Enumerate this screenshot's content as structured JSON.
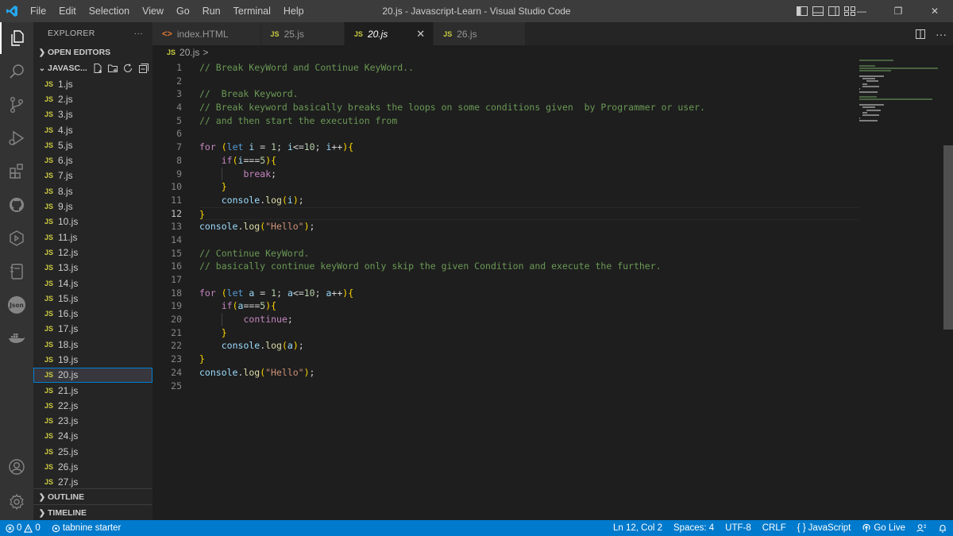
{
  "titlebar": {
    "menu": [
      "File",
      "Edit",
      "Selection",
      "View",
      "Go",
      "Run",
      "Terminal",
      "Help"
    ],
    "window_title": "20.js - Javascript-Learn - Visual Studio Code"
  },
  "sidebar": {
    "title": "EXPLORER",
    "more": "···",
    "open_editors": "OPEN EDITORS",
    "folder": "JAVASC...",
    "files": [
      "1.js",
      "2.js",
      "3.js",
      "4.js",
      "5.js",
      "6.js",
      "7.js",
      "8.js",
      "9.js",
      "10.js",
      "11.js",
      "12.js",
      "13.js",
      "14.js",
      "15.js",
      "16.js",
      "17.js",
      "18.js",
      "19.js",
      "20.js",
      "21.js",
      "22.js",
      "23.js",
      "24.js",
      "25.js",
      "26.js",
      "27.js"
    ],
    "selected_file": "20.js",
    "outline": "OUTLINE",
    "timeline": "TIMELINE",
    "js_badge": "JS"
  },
  "tabs": [
    {
      "label": "index.HTML",
      "icon": "<>"
    },
    {
      "label": "25.js",
      "icon": "JS"
    },
    {
      "label": "20.js",
      "icon": "JS",
      "active": true
    },
    {
      "label": "26.js",
      "icon": "JS"
    }
  ],
  "breadcrumb": {
    "icon": "JS",
    "file": "20.js",
    "sep": ">"
  },
  "editor": {
    "current_line": 12,
    "line_numbers": [
      "1",
      "2",
      "3",
      "4",
      "5",
      "6",
      "7",
      "8",
      "9",
      "10",
      "11",
      "12",
      "13",
      "14",
      "15",
      "16",
      "17",
      "18",
      "19",
      "20",
      "21",
      "22",
      "23",
      "24",
      "25"
    ],
    "lines": [
      "// Break KeyWord and Continue KeyWord..",
      "",
      "//  Break Keyword.",
      "// Break keyword basically breaks the loops on some conditions given  by Programmer or user.",
      "// and then start the execution from",
      "",
      "for (let i = 1; i<=10; i++){",
      "    if(i===5){",
      "        break;",
      "    }",
      "    console.log(i);",
      "}",
      "console.log(\"Hello\");",
      "",
      "// Continue KeyWord.",
      "// basically continue keyWord only skip the given Condition and execute the further.",
      "",
      "for (let a = 1; a<=10; a++){",
      "    if(a===5){",
      "        continue;",
      "    }",
      "    console.log(a);",
      "}",
      "console.log(\"Hello\");",
      ""
    ]
  },
  "statusbar": {
    "errors": "0",
    "warnings": "0",
    "tabnine": "tabnine starter",
    "position": "Ln 12, Col 2",
    "spaces": "Spaces: 4",
    "encoding": "UTF-8",
    "eol": "CRLF",
    "language": "JavaScript",
    "golive": "Go Live"
  },
  "colors": {
    "accent": "#007acc",
    "titlebar": "#3c3c3c",
    "activitybar": "#333333",
    "sidebar": "#252526",
    "editor": "#1e1e1e",
    "comment": "#6a9955",
    "keyword": "#c586c0",
    "js_icon": "#cbcb41"
  },
  "icons": {
    "activitybar": [
      "explorer-icon",
      "search-icon",
      "source-control-icon",
      "run-debug-icon",
      "extensions-icon",
      "github-icon",
      "remote-explorer-icon",
      "notebook-icon",
      "json-icon",
      "docker-icon",
      "account-icon",
      "settings-gear-icon"
    ]
  }
}
